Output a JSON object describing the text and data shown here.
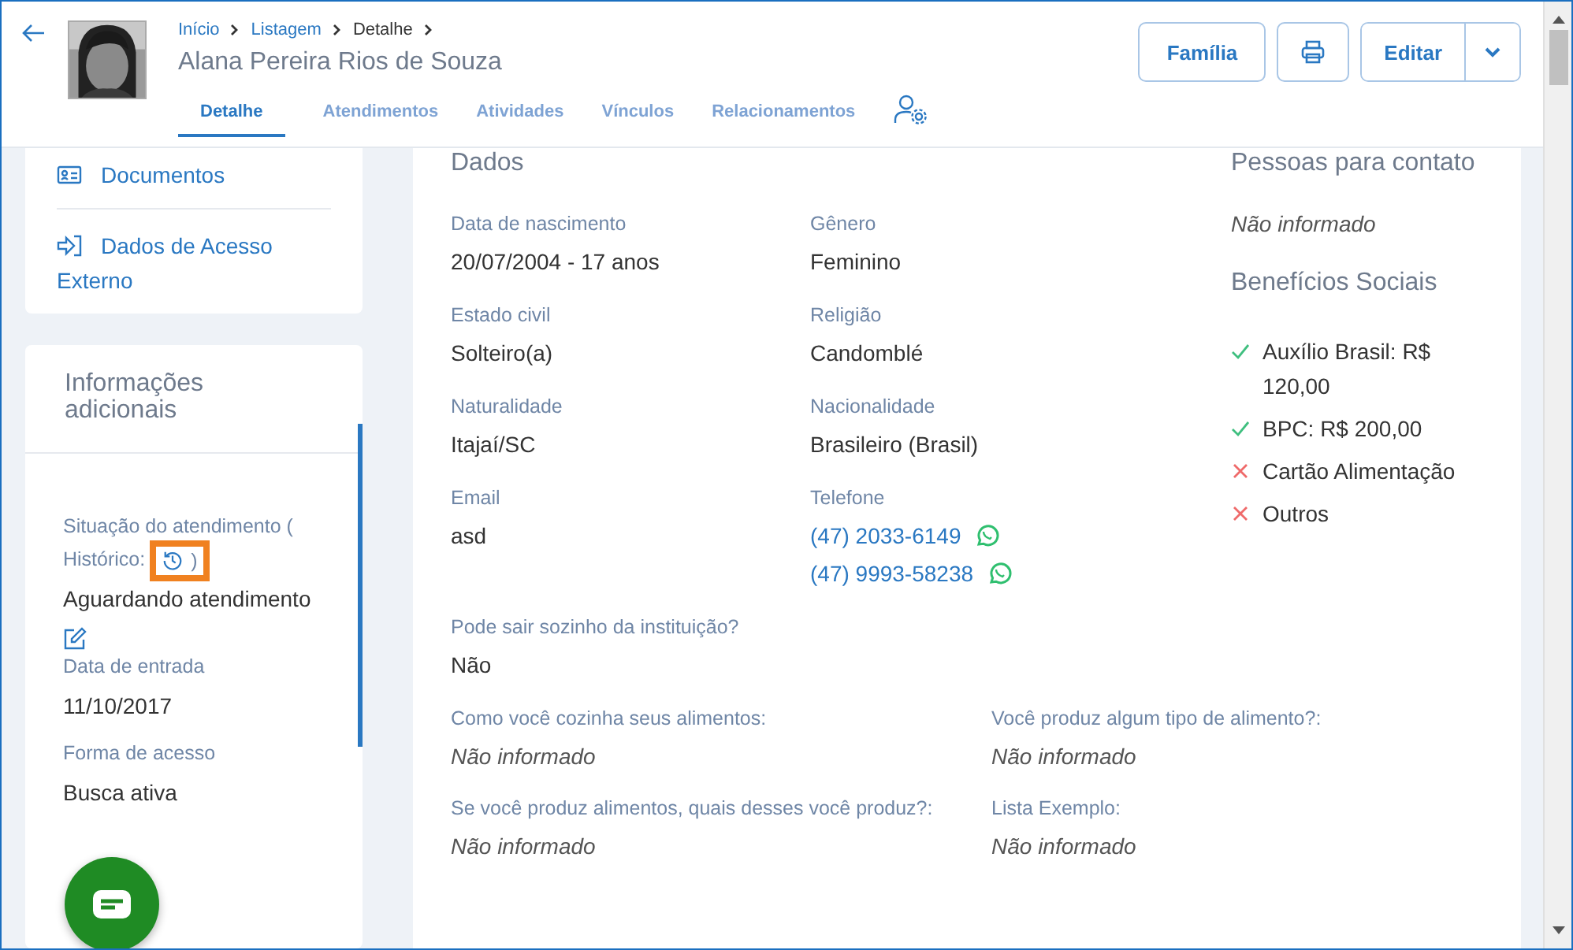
{
  "header": {
    "breadcrumb": [
      {
        "label": "Início",
        "current": false
      },
      {
        "label": "Listagem",
        "current": false
      },
      {
        "label": "Detalhe",
        "current": true
      }
    ],
    "name": "Alana Pereira Rios de Souza",
    "tabs": [
      {
        "label": "Detalhe",
        "selected": true
      },
      {
        "label": "Atendimentos",
        "selected": false
      },
      {
        "label": "Atividades",
        "selected": false
      },
      {
        "label": "Vínculos",
        "selected": false
      },
      {
        "label": "Relacionamentos",
        "selected": false
      }
    ],
    "buttons": [
      {
        "kind": "text",
        "label": "Família"
      },
      {
        "kind": "print"
      },
      {
        "kind": "split",
        "label": "Editar"
      }
    ]
  },
  "sidebar": {
    "links": [
      {
        "label": "Documentos"
      },
      {
        "label": "Dados de Acesso Externo"
      }
    ],
    "info": {
      "title": "Informações adicionais",
      "status": {
        "label": "Situação do atendimento (",
        "history_label": "Histórico:",
        "closing": ")",
        "value": "Aguardando atendimento",
        "highlighted": true
      },
      "fields": [
        {
          "label": "Data de entrada",
          "value": "11/10/2017"
        },
        {
          "label": "Forma de acesso",
          "value": "Busca ativa"
        }
      ]
    }
  },
  "dados": {
    "title": "Dados",
    "fields": [
      {
        "kind": "text",
        "label": "Data de nascimento",
        "value": "20/07/2004 - 17 anos"
      },
      {
        "kind": "text",
        "label": "Gênero",
        "value": "Feminino"
      },
      {
        "kind": "text",
        "label": "Estado civil",
        "value": "Solteiro(a)"
      },
      {
        "kind": "text",
        "label": "Religião",
        "value": "Candomblé"
      },
      {
        "kind": "text",
        "label": "Naturalidade",
        "value": "Itajaí/SC"
      },
      {
        "kind": "text",
        "label": "Nacionalidade",
        "value": "Brasileiro (Brasil)"
      },
      {
        "kind": "text",
        "label": "Email",
        "value": "asd"
      },
      {
        "kind": "phones",
        "label": "Telefone",
        "values": [
          "(47) 2033-6149",
          "(47) 9993-58238"
        ]
      },
      {
        "kind": "wide",
        "label": "Pode sair sozinho da instituição?",
        "value": "Não"
      }
    ],
    "extra_fields": [
      {
        "label": "Como você cozinha seus alimentos:",
        "value": "Não informado",
        "informed": false
      },
      {
        "label": "Você produz algum tipo de alimento?:",
        "value": "Não informado",
        "informed": false
      },
      {
        "label": "Se você produz alimentos, quais desses você produz?:",
        "value": "Não informado",
        "informed": false
      },
      {
        "label": "Lista Exemplo:",
        "value": "Não informado",
        "informed": false
      }
    ]
  },
  "contacts": {
    "title": "Pessoas para contato",
    "value": "Não informado",
    "informed": false
  },
  "benefits": {
    "title": "Benefícios Sociais",
    "items": [
      {
        "label": "Auxílio Brasil: R$ 120,00",
        "received": true
      },
      {
        "label": "BPC: R$ 200,00",
        "received": true
      },
      {
        "label": "Cartão Alimentação",
        "received": false
      },
      {
        "label": "Outros",
        "received": false
      }
    ]
  }
}
